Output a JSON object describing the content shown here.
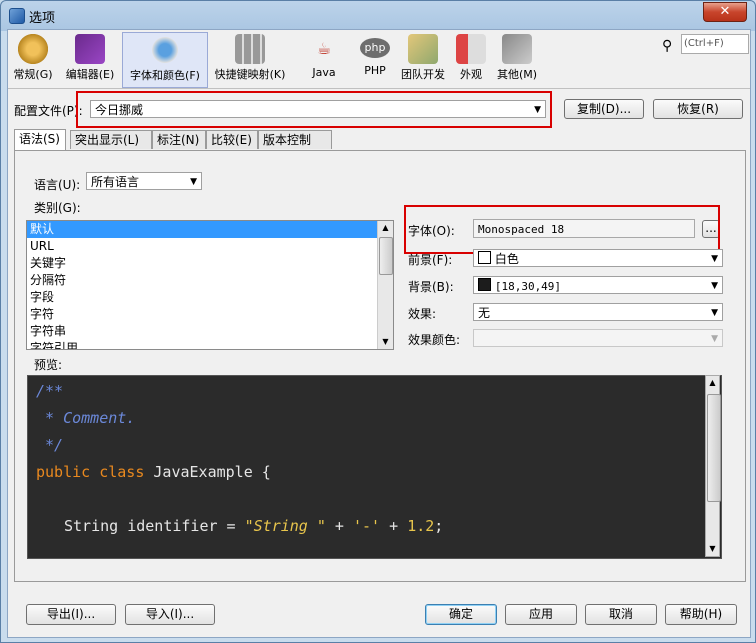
{
  "window": {
    "title": "选项",
    "close": "✕"
  },
  "categories": [
    {
      "label": "常规(G)",
      "icon": "general-icon"
    },
    {
      "label": "编辑器(E)",
      "icon": "editor-icon"
    },
    {
      "label": "字体和颜色(F)",
      "icon": "fonts-colors-icon"
    },
    {
      "label": "快捷键映射(K)",
      "icon": "keymap-icon"
    },
    {
      "label": "Java",
      "icon": "java-icon"
    },
    {
      "label": "PHP",
      "icon": "php-icon"
    },
    {
      "label": "团队开发",
      "icon": "team-icon"
    },
    {
      "label": "外观",
      "icon": "appearance-icon"
    },
    {
      "label": "其他(M)",
      "icon": "misc-icon"
    }
  ],
  "search": {
    "placeholder": "(Ctrl+F)"
  },
  "profile": {
    "label": "配置文件(P):",
    "value": "今日挪威",
    "copy": "复制(D)...",
    "restore": "恢复(R)"
  },
  "tabs": [
    "语法(S)",
    "突出显示(L)",
    "标注(N)",
    "比较(E)",
    "版本控制(V)"
  ],
  "language": {
    "label": "语言(U):",
    "value": "所有语言"
  },
  "category": {
    "label": "类别(G):",
    "items": [
      "默认",
      "URL",
      "关键字",
      "分隔符",
      "字段",
      "字符",
      "字符串",
      "字符引用"
    ]
  },
  "font": {
    "label": "字体(O):",
    "value": "Monospaced 18",
    "browse": "..."
  },
  "foreground": {
    "label": "前景(F):",
    "value": "白色",
    "swatch": "#ffffff"
  },
  "background": {
    "label": "背景(B):",
    "value": "[18,30,49]",
    "swatch": "#1c1c1c"
  },
  "effects": {
    "label": "效果:",
    "value": "无"
  },
  "effect_color": {
    "label": "效果颜色:",
    "value": ""
  },
  "preview": {
    "label": "预览:",
    "line1": "/**",
    "line2": " * Comment.",
    "line3": " */",
    "line4_kw1": "public",
    "line4_kw2": "class",
    "line4_rest": "JavaExample {",
    "line5_type": "String identifier = ",
    "line5_str": "\"String \"",
    "line5_op1": " + ",
    "line5_chr": "'-'",
    "line5_op2": " + ",
    "line5_num": "1.2",
    "line5_end": ";"
  },
  "footer": {
    "export": "导出(I)...",
    "import": "导入(I)...",
    "ok": "确定",
    "apply": "应用",
    "cancel": "取消",
    "help": "帮助(H)"
  },
  "colors": {
    "highlight_box": "#d80000",
    "selection": "#3399ff"
  }
}
